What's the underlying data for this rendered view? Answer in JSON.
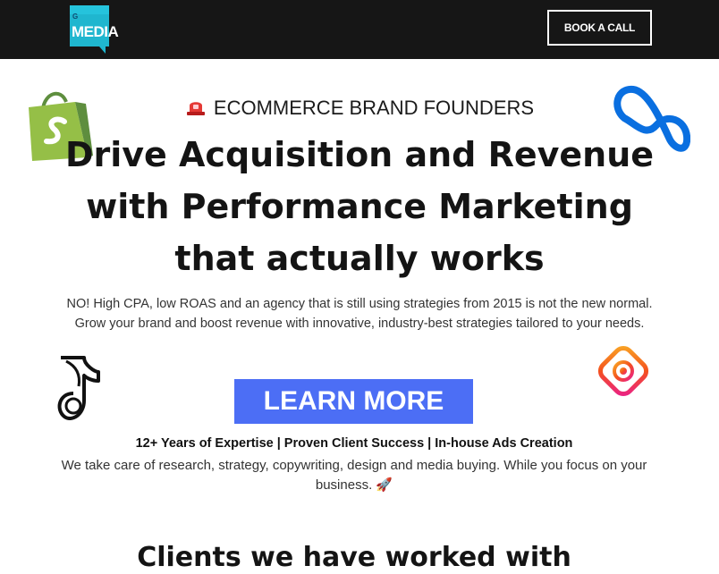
{
  "header": {
    "logo_small": "G",
    "logo_text": "MEDIA",
    "book_button": "BOOK A CALL"
  },
  "hero": {
    "eyebrow_icon": "siren-icon",
    "eyebrow": "ECOMMERCE BRAND FOUNDERS",
    "headline_line1": "Drive Acquisition and Revenue",
    "headline_line2": "with Performance Marketing",
    "headline_line3": "that actually works",
    "subtext": "NO! High CPA, low ROAS and an agency that is still using strategies from 2015 is not the new normal. Grow your brand and boost revenue with innovative, industry-best strategies tailored to your needs.",
    "cta": "LEARN MORE",
    "expertise": "12+ Years of Expertise | Proven Client Success | In-house Ads Creation",
    "care_text": "We take care of research, strategy, copywriting, design and media buying. While you focus on your business.",
    "rocket": "🚀"
  },
  "clients": {
    "title": "Clients we have worked with"
  },
  "decorations": {
    "shopify": "shopify-bag-icon",
    "meta": "meta-infinity-icon",
    "tiktok": "tiktok-style-icon",
    "instagram": "instagram-style-icon"
  },
  "colors": {
    "header_bg": "#161616",
    "cta_bg": "#4c6ef5",
    "logo_bg": "#1fb6cf"
  }
}
